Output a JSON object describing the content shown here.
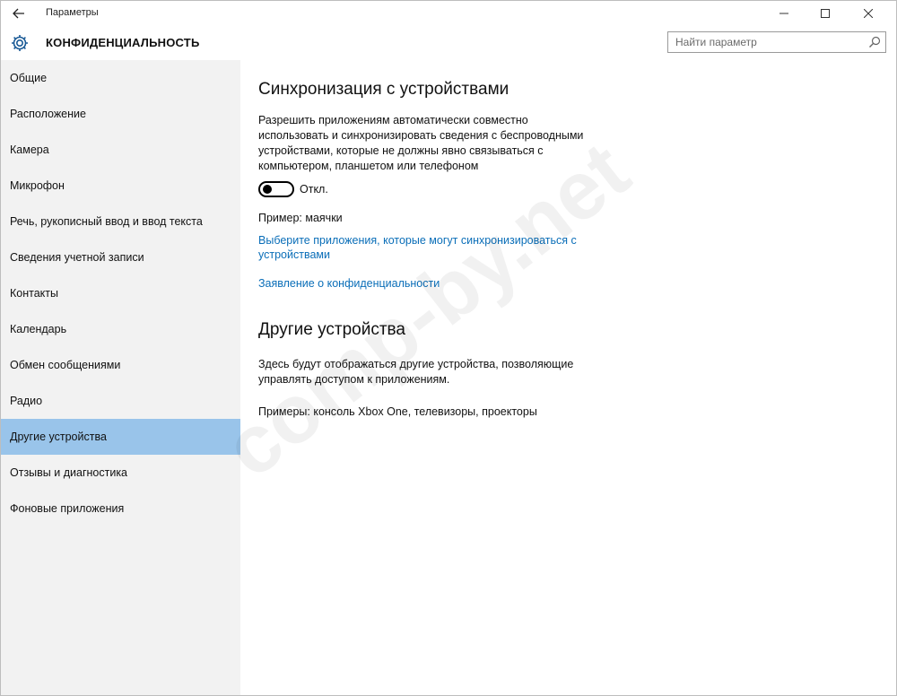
{
  "window": {
    "title": "Параметры"
  },
  "header": {
    "title": "КОНФИДЕНЦИАЛЬНОСТЬ"
  },
  "search": {
    "placeholder": "Найти параметр"
  },
  "sidebar": {
    "items": [
      {
        "label": "Общие"
      },
      {
        "label": "Расположение"
      },
      {
        "label": "Камера"
      },
      {
        "label": "Микрофон"
      },
      {
        "label": "Речь, рукописный ввод и ввод текста"
      },
      {
        "label": "Сведения учетной записи"
      },
      {
        "label": "Контакты"
      },
      {
        "label": "Календарь"
      },
      {
        "label": "Обмен сообщениями"
      },
      {
        "label": "Радио"
      },
      {
        "label": "Другие устройства",
        "active": true
      },
      {
        "label": "Отзывы и диагностика"
      },
      {
        "label": "Фоновые приложения"
      }
    ]
  },
  "sync": {
    "heading": "Синхронизация с устройствами",
    "description": "Разрешить приложениям автоматически совместно использовать и синхронизировать сведения с беспроводными устройствами, которые не должны явно связываться с компьютером, планшетом или телефоном",
    "toggle_state": "Откл.",
    "example": "Пример: маячки",
    "choose_apps_link": "Выберите приложения, которые могут синхронизироваться с устройствами",
    "privacy_link": "Заявление о конфиденциальности"
  },
  "other": {
    "heading": "Другие устройства",
    "description": "Здесь будут отображаться другие устройства, позволяющие управлять доступом к приложениям.",
    "examples": "Примеры: консоль Xbox One, телевизоры, проекторы"
  },
  "watermark": "comp-by.net",
  "colors": {
    "accent": "#0a6eb8",
    "active_item": "#99c4ea",
    "sidebar_bg": "#f2f2f2"
  }
}
